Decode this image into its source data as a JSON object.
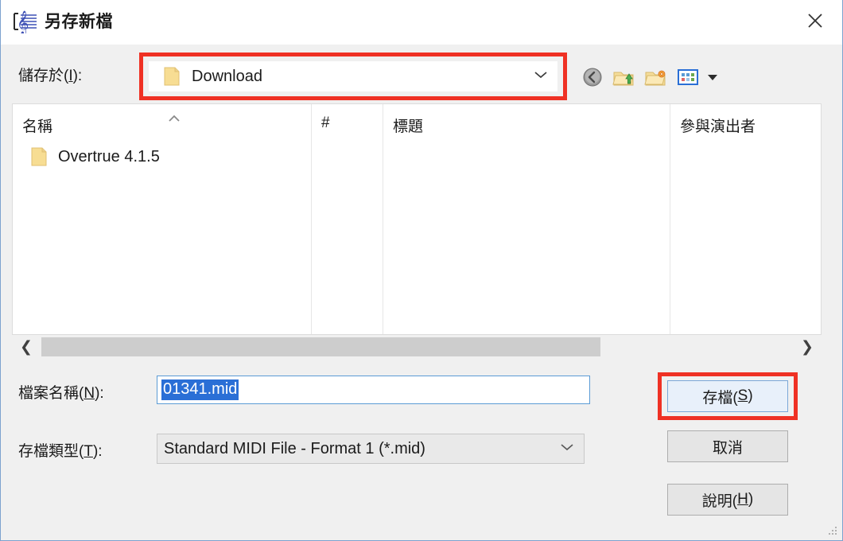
{
  "window": {
    "title": "另存新檔",
    "app_icon": "music-score-icon",
    "close_label": "✕",
    "border_color": "#7da2ce"
  },
  "savein": {
    "label": "儲存於(I):",
    "value": "Download",
    "icon": "folder-icon",
    "chevron": "chevron-down-icon",
    "highlight_color": "#ef3124"
  },
  "toolbar": {
    "items": [
      {
        "name": "back-icon",
        "tooltip": "上一個"
      },
      {
        "name": "up-folder-icon",
        "tooltip": "上一層"
      },
      {
        "name": "new-folder-icon",
        "tooltip": "建立新資料夾"
      },
      {
        "name": "views-icon",
        "tooltip": "檢視"
      }
    ],
    "views_dropdown": "chevron-down-icon"
  },
  "filelist": {
    "columns": [
      {
        "label": "名稱",
        "sorted": true,
        "sort_icon": "sort-ascending-chevron"
      },
      {
        "label": "#",
        "sorted": false
      },
      {
        "label": "標題",
        "sorted": false
      },
      {
        "label": "參與演出者",
        "sorted": false
      }
    ],
    "rows": [
      {
        "icon": "folder-icon",
        "name": "Overtrue 4.1.5",
        "number": "",
        "title": "",
        "artists": ""
      }
    ]
  },
  "scrollbar": {
    "left_arrow": "❮",
    "right_arrow": "❯"
  },
  "form": {
    "filename_label": "檔案名稱(N):",
    "filename_value": "01341.mid",
    "filename_accelerator": "N",
    "filetype_label": "存檔類型(T):",
    "filetype_value": "Standard MIDI File - Format 1 (*.mid)",
    "filetype_accelerator": "T",
    "filetype_chevron": "chevron-down-icon"
  },
  "buttons": {
    "save": "存檔(S)",
    "cancel": "取消",
    "help": "說明(H)",
    "save_highlight_color": "#ef3124"
  }
}
